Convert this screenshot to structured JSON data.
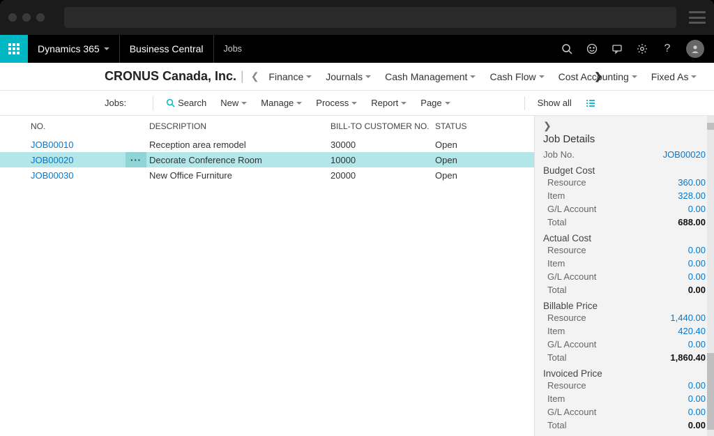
{
  "header": {
    "product": "Dynamics 365",
    "module": "Business Central",
    "breadcrumb": "Jobs"
  },
  "nav": {
    "company": "CRONUS Canada, Inc.",
    "items": [
      "Finance",
      "Journals",
      "Cash Management",
      "Cash Flow",
      "Cost Accounting",
      "Fixed As"
    ]
  },
  "toolbar": {
    "list_label": "Jobs:",
    "search": "Search",
    "items": [
      "New",
      "Manage",
      "Process",
      "Report",
      "Page"
    ],
    "show_all": "Show all"
  },
  "table": {
    "columns": {
      "no": "NO.",
      "desc": "DESCRIPTION",
      "bill": "BILL-TO CUSTOMER NO.",
      "status": "STATUS"
    },
    "rows": [
      {
        "no": "JOB00010",
        "desc": "Reception area remodel",
        "bill": "30000",
        "status": "Open"
      },
      {
        "no": "JOB00020",
        "desc": "Decorate Conference Room",
        "bill": "10000",
        "status": "Open"
      },
      {
        "no": "JOB00030",
        "desc": "New Office Furniture",
        "bill": "20000",
        "status": "Open"
      }
    ],
    "selected_index": 1
  },
  "details": {
    "title": "Job Details",
    "job_no_label": "Job No.",
    "job_no": "JOB00020",
    "sections": [
      {
        "title": "Budget Cost",
        "resource": "360.00",
        "item": "328.00",
        "gl": "0.00",
        "total": "688.00"
      },
      {
        "title": "Actual Cost",
        "resource": "0.00",
        "item": "0.00",
        "gl": "0.00",
        "total": "0.00"
      },
      {
        "title": "Billable Price",
        "resource": "1,440.00",
        "item": "420.40",
        "gl": "0.00",
        "total": "1,860.40"
      },
      {
        "title": "Invoiced Price",
        "resource": "0.00",
        "item": "0.00",
        "gl": "0.00",
        "total": "0.00"
      }
    ],
    "labels": {
      "resource": "Resource",
      "item": "Item",
      "gl": "G/L Account",
      "total": "Total"
    }
  }
}
